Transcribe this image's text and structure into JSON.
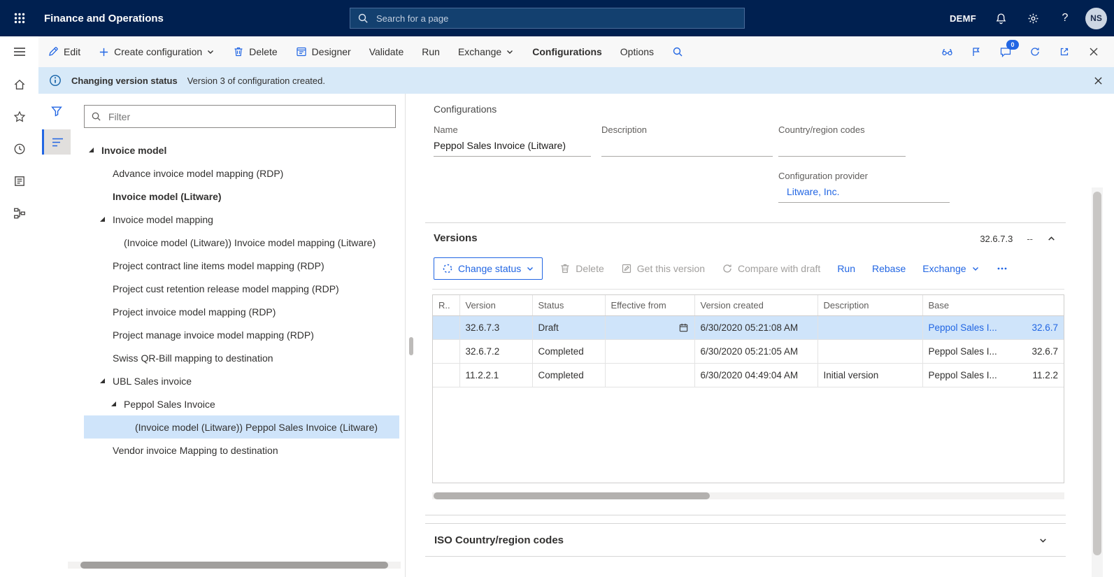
{
  "topbar": {
    "app_title": "Finance and Operations",
    "search_placeholder": "Search for a page",
    "company": "DEMF",
    "avatar_initials": "NS"
  },
  "action_pane": {
    "items": [
      {
        "label": "Edit",
        "icon": "pencil"
      },
      {
        "label": "Create configuration",
        "icon": "plus",
        "dropdown": true
      },
      {
        "label": "Delete",
        "icon": "trash"
      },
      {
        "label": "Designer",
        "icon": "designer"
      },
      {
        "label": "Validate"
      },
      {
        "label": "Run"
      },
      {
        "label": "Exchange",
        "dropdown": true
      },
      {
        "label": "Configurations",
        "active": true
      },
      {
        "label": "Options"
      },
      {
        "label": "",
        "icon": "search",
        "name": "find"
      }
    ],
    "message_badge": "0"
  },
  "message_bar": {
    "title": "Changing version status",
    "text": "Version 3 of configuration created."
  },
  "tree": {
    "filter_placeholder": "Filter",
    "items": [
      {
        "label": "Invoice model",
        "level": 0,
        "expander": true,
        "bold": true
      },
      {
        "label": "Advance invoice model mapping (RDP)",
        "level": 1
      },
      {
        "label": "Invoice model (Litware)",
        "level": 1,
        "bold": true
      },
      {
        "label": "Invoice model mapping",
        "level": 1,
        "expander": true
      },
      {
        "label": "(Invoice model (Litware)) Invoice model mapping (Litware)",
        "level": 2
      },
      {
        "label": "Project contract line items model mapping (RDP)",
        "level": 1
      },
      {
        "label": "Project cust retention release model mapping (RDP)",
        "level": 1
      },
      {
        "label": "Project invoice model mapping (RDP)",
        "level": 1
      },
      {
        "label": "Project manage invoice model mapping (RDP)",
        "level": 1
      },
      {
        "label": "Swiss QR-Bill mapping to destination",
        "level": 1
      },
      {
        "label": "UBL Sales invoice",
        "level": 1,
        "expander": true
      },
      {
        "label": "Peppol Sales Invoice",
        "level": 2,
        "expander": true
      },
      {
        "label": "(Invoice model (Litware)) Peppol Sales Invoice (Litware)",
        "level": 3,
        "selected": true
      },
      {
        "label": "Vendor invoice Mapping to destination",
        "level": 1
      }
    ]
  },
  "details": {
    "caption": "Configurations",
    "name_label": "Name",
    "name_value": "Peppol Sales Invoice (Litware)",
    "description_label": "Description",
    "description_value": "",
    "country_label": "Country/region codes",
    "country_value": "",
    "provider_label": "Configuration provider",
    "provider_value": "Litware, Inc."
  },
  "versions": {
    "title": "Versions",
    "summary_version": "32.6.7.3",
    "summary_extra": "--",
    "toolbar": [
      {
        "label": "Change status",
        "icon": "status",
        "dropdown": true,
        "variant": "primary"
      },
      {
        "label": "Delete",
        "icon": "trash",
        "disabled": true
      },
      {
        "label": "Get this version",
        "icon": "getversion",
        "disabled": true
      },
      {
        "label": "Compare with draft",
        "icon": "sync",
        "disabled": true
      },
      {
        "label": "Run"
      },
      {
        "label": "Rebase"
      },
      {
        "label": "Exchange",
        "dropdown": true
      },
      {
        "label": "",
        "icon": "more",
        "name": "more"
      }
    ],
    "columns": [
      "R..",
      "Version",
      "Status",
      "Effective from",
      "Version created",
      "Description",
      "Base"
    ],
    "rows": [
      {
        "version": "32.6.7.3",
        "status": "Draft",
        "effective_from": "",
        "created": "6/30/2020 05:21:08 AM",
        "description": "",
        "base_name": "Peppol Sales I...",
        "base_version": "32.6.7",
        "selected": true
      },
      {
        "version": "32.6.7.2",
        "status": "Completed",
        "effective_from": "",
        "created": "6/30/2020 05:21:05 AM",
        "description": "",
        "base_name": "Peppol Sales I...",
        "base_version": "32.6.7"
      },
      {
        "version": "11.2.2.1",
        "status": "Completed",
        "effective_from": "",
        "created": "6/30/2020 04:49:04 AM",
        "description": "Initial version",
        "base_name": "Peppol Sales I...",
        "base_version": "11.2.2"
      }
    ]
  },
  "iso_section": {
    "title": "ISO Country/region codes"
  },
  "colors": {
    "topbar": "#002050",
    "accent": "#2266e3",
    "selection": "#cfe4fa",
    "infobar": "#d7e9f8",
    "disabled": "#a19f9d"
  }
}
